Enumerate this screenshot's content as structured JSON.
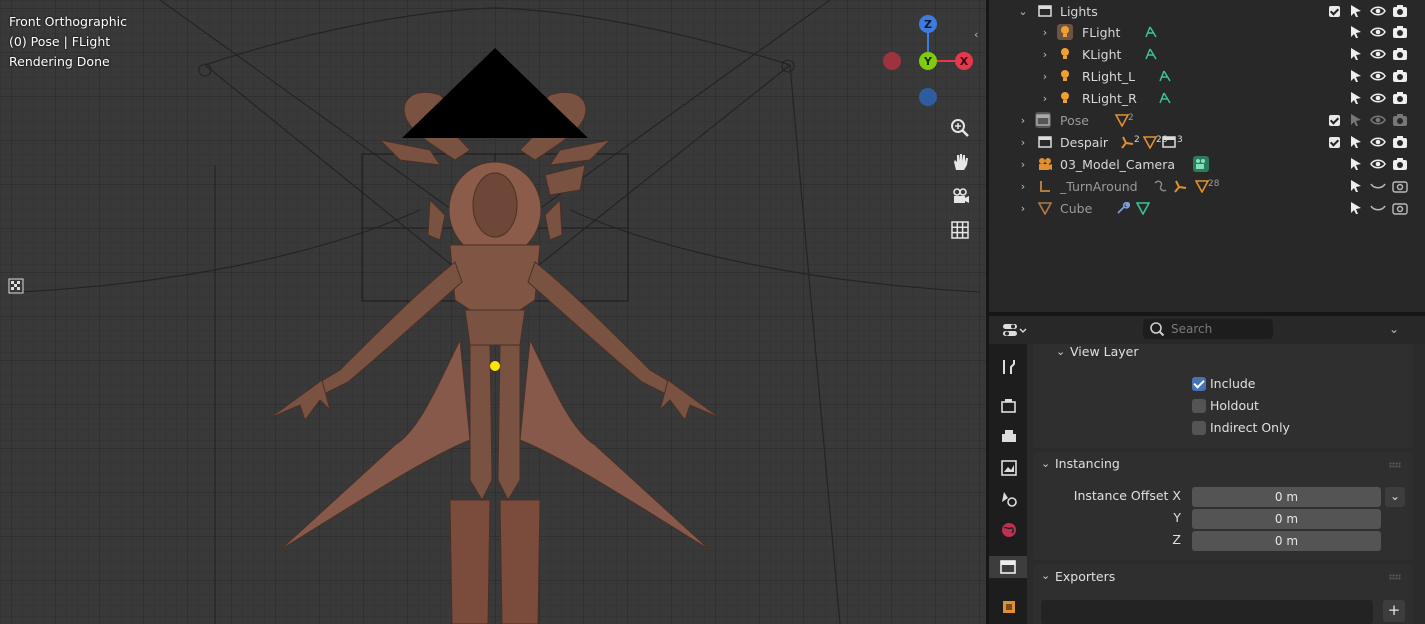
{
  "viewport": {
    "info_lines": [
      "Front Orthographic",
      "(0) Pose | FLight",
      "Rendering Done"
    ],
    "gizmo": {
      "z": "Z",
      "y": "Y",
      "x": "X"
    },
    "tools": [
      "zoom-icon",
      "hand-pan-icon",
      "camera-view-icon",
      "grid-ortho-icon"
    ],
    "colors": {
      "x_axis": "#e5384d",
      "y_axis": "#7fcc0e",
      "z_axis": "#3e7be0",
      "selection_dot": "#ffe600"
    }
  },
  "outliner": {
    "rows": [
      {
        "name": "Lights",
        "kind": "collection"
      },
      {
        "name": "FLight",
        "kind": "light"
      },
      {
        "name": "KLight",
        "kind": "light"
      },
      {
        "name": "RLight_L",
        "kind": "light"
      },
      {
        "name": "RLight_R",
        "kind": "light"
      },
      {
        "name": "Pose",
        "kind": "collection",
        "badge": "2"
      },
      {
        "name": "Despair",
        "kind": "collection",
        "badges": [
          "2",
          "26",
          "3"
        ]
      },
      {
        "name": "03_Model_Camera",
        "kind": "camera"
      },
      {
        "name": "_TurnAround",
        "kind": "armature",
        "badge": "28"
      },
      {
        "name": "Cube",
        "kind": "mesh"
      }
    ]
  },
  "properties": {
    "search_placeholder": "Search",
    "view_layer": {
      "title": "View Layer",
      "options": [
        {
          "label": "Include",
          "checked": true
        },
        {
          "label": "Holdout",
          "checked": false
        },
        {
          "label": "Indirect Only",
          "checked": false
        }
      ]
    },
    "instancing": {
      "title": "Instancing",
      "offset_label": "Instance Offset X",
      "y_label": "Y",
      "z_label": "Z",
      "x_value": "0 m",
      "y_value": "0 m",
      "z_value": "0 m"
    },
    "exporters": {
      "title": "Exporters",
      "add": "+"
    }
  }
}
